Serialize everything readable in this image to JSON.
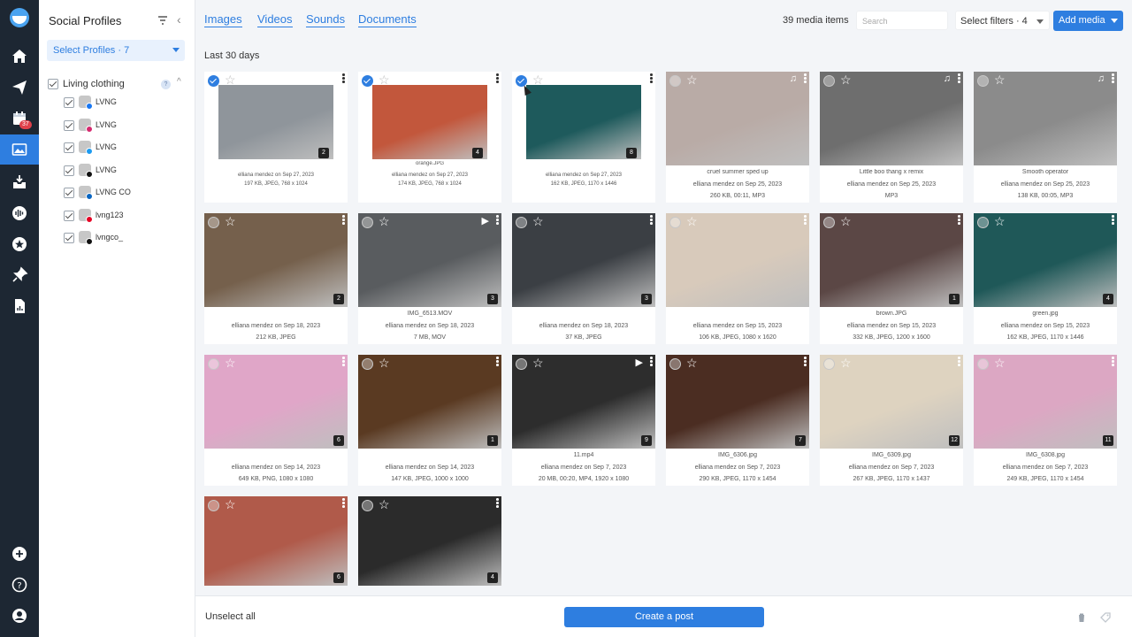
{
  "sidebar": {
    "notification_badge": "37"
  },
  "profiles_panel": {
    "title": "Social Profiles",
    "select_label": "Select Profiles · 7",
    "group": {
      "label": "Living clothing",
      "help": "?"
    },
    "profiles": [
      {
        "name": "LVNG",
        "network": "facebook",
        "color": "#1877f2"
      },
      {
        "name": "LVNG",
        "network": "instagram",
        "color": "#d6296e"
      },
      {
        "name": "LVNG",
        "network": "twitter",
        "color": "#1d9bf0"
      },
      {
        "name": "LVNG",
        "network": "tiktok",
        "color": "#111111"
      },
      {
        "name": "LVNG CO",
        "network": "linkedin",
        "color": "#0a66c2"
      },
      {
        "name": "lvng123",
        "network": "pinterest",
        "color": "#e60023"
      },
      {
        "name": "lvngco_",
        "network": "tiktok",
        "color": "#111111"
      }
    ]
  },
  "main": {
    "tabs": [
      "Images",
      "Videos",
      "Sounds",
      "Documents"
    ],
    "media_count": "39 media items",
    "search_placeholder": "Search",
    "filters_label": "Select filters · 4",
    "add_media_label": "Add media",
    "section_label": "Last 30 days"
  },
  "media": [
    {
      "filename": "",
      "meta1": "elliana mendez on Sep 27, 2023",
      "meta2": "197 KB, JPEG, 768 x 1024",
      "count": "2",
      "selected": true,
      "type": "image",
      "color": "#8f959b"
    },
    {
      "filename": "orange.JPG",
      "meta1": "elliana mendez on Sep 27, 2023",
      "meta2": "174 KB, JPEG, 768 x 1024",
      "count": "4",
      "selected": true,
      "type": "image",
      "color": "#c2573c"
    },
    {
      "filename": "",
      "meta1": "elliana mendez on Sep 27, 2023",
      "meta2": "162 KB, JPEG, 1170 x 1446",
      "count": "8",
      "selected": true,
      "type": "image",
      "color": "#1e5a5c"
    },
    {
      "filename": "cruel summer sped up",
      "meta1": "elliana mendez on Sep 25, 2023",
      "meta2": "260 KB, 00:11, MP3",
      "count": "",
      "selected": false,
      "type": "audio",
      "color": "#b9aba6"
    },
    {
      "filename": "Little boo thang x remix",
      "meta1": "elliana mendez on Sep 25, 2023",
      "meta2": "MP3",
      "count": "",
      "selected": false,
      "type": "audio",
      "color": "#6e6e6e"
    },
    {
      "filename": "Smooth operator",
      "meta1": "elliana mendez on Sep 25, 2023",
      "meta2": "138 KB, 00:05, MP3",
      "count": "",
      "selected": false,
      "type": "audio",
      "color": "#8b8b8b"
    },
    {
      "filename": "",
      "meta1": "elliana mendez on Sep 18, 2023",
      "meta2": "212 KB, JPEG",
      "count": "2",
      "selected": false,
      "type": "image",
      "color": "#75604c"
    },
    {
      "filename": "IMG_6513.MOV",
      "meta1": "elliana mendez on Sep 18, 2023",
      "meta2": "7 MB, MOV",
      "count": "3",
      "selected": false,
      "type": "video",
      "color": "#595c5f"
    },
    {
      "filename": "",
      "meta1": "elliana mendez on Sep 18, 2023",
      "meta2": "37 KB, JPEG",
      "count": "3",
      "selected": false,
      "type": "image",
      "color": "#3b3f44"
    },
    {
      "filename": "",
      "meta1": "elliana mendez on Sep 15, 2023",
      "meta2": "106 KB, JPEG, 1080 x 1620",
      "count": "",
      "selected": false,
      "type": "image",
      "color": "#d8cabb"
    },
    {
      "filename": "brown.JPG",
      "meta1": "elliana mendez on Sep 15, 2023",
      "meta2": "332 KB, JPEG, 1200 x 1600",
      "count": "1",
      "selected": false,
      "type": "image",
      "color": "#5b4745"
    },
    {
      "filename": "green.jpg",
      "meta1": "elliana mendez on Sep 15, 2023",
      "meta2": "162 KB, JPEG, 1170 x 1446",
      "count": "4",
      "selected": false,
      "type": "image",
      "color": "#1f5858"
    },
    {
      "filename": "",
      "meta1": "elliana mendez on Sep 14, 2023",
      "meta2": "649 KB, PNG, 1080 x 1080",
      "count": "6",
      "selected": false,
      "type": "image",
      "color": "#e0a6c8"
    },
    {
      "filename": "",
      "meta1": "elliana mendez on Sep 14, 2023",
      "meta2": "147 KB, JPEG, 1000 x 1000",
      "count": "1",
      "selected": false,
      "type": "image",
      "color": "#5a3a22"
    },
    {
      "filename": "11.mp4",
      "meta1": "elliana mendez on Sep 7, 2023",
      "meta2": "20 MB, 00:20, MP4, 1920 x 1080",
      "count": "9",
      "selected": false,
      "type": "video",
      "color": "#2d2d2d"
    },
    {
      "filename": "IMG_6306.jpg",
      "meta1": "elliana mendez on Sep 7, 2023",
      "meta2": "290 KB, JPEG, 1170 x 1454",
      "count": "7",
      "selected": false,
      "type": "image",
      "color": "#4b2d22"
    },
    {
      "filename": "IMG_6309.jpg",
      "meta1": "elliana mendez on Sep 7, 2023",
      "meta2": "267 KB, JPEG, 1170 x 1437",
      "count": "12",
      "selected": false,
      "type": "image",
      "color": "#ded3c0"
    },
    {
      "filename": "IMG_6308.jpg",
      "meta1": "elliana mendez on Sep 7, 2023",
      "meta2": "249 KB, JPEG, 1170 x 1454",
      "count": "11",
      "selected": false,
      "type": "image",
      "color": "#dca7c3"
    },
    {
      "filename": "",
      "meta1": "",
      "meta2": "",
      "count": "6",
      "selected": false,
      "type": "image",
      "color": "#b05a4a"
    },
    {
      "filename": "",
      "meta1": "",
      "meta2": "",
      "count": "4",
      "selected": false,
      "type": "image",
      "color": "#2b2b2b"
    }
  ],
  "bottom_bar": {
    "unselect_label": "Unselect all",
    "create_label": "Create a post"
  },
  "colors": {
    "accent": "#2e7ee0",
    "rail": "#1d2733"
  }
}
